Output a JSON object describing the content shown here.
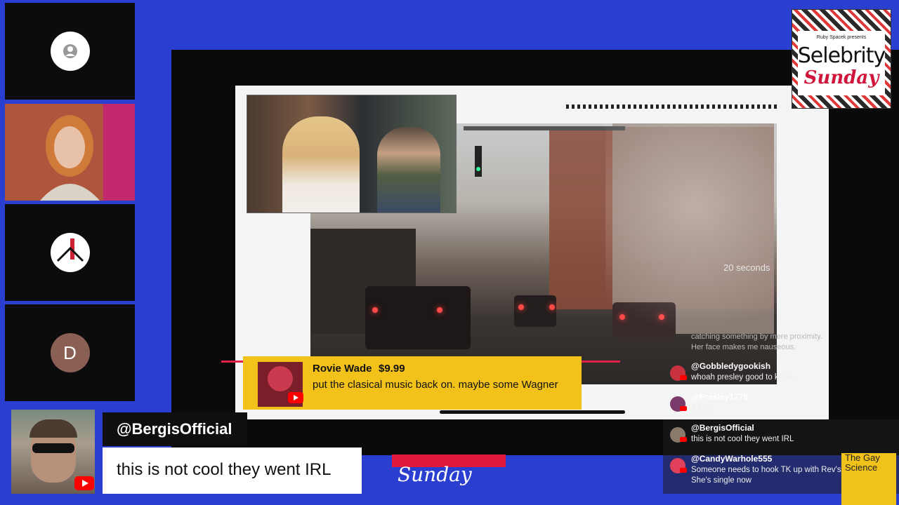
{
  "participants": {
    "tile1": {
      "icon": "user-icon"
    },
    "tile2": {
      "icon": "video-feed"
    },
    "tile3": {
      "icon": "logo-avatar"
    },
    "tile4": {
      "initial": "D"
    }
  },
  "stage": {
    "timer_text": "20 seconds"
  },
  "superchat": {
    "name": "Rovie Wade",
    "amount": "$9.99",
    "message": "put the clasical music back on. maybe some Wagner"
  },
  "logo": {
    "presents": "Ruby Spacek presents",
    "title": "Selebrity",
    "subtitle": "Sunday"
  },
  "chat": {
    "faded_lines": [
      "catching something by mere proximity.",
      "Her face makes me nauseous."
    ],
    "messages": [
      {
        "user": "@Gobbledygookish",
        "text": "whoah presley good to know"
      },
      {
        "user": "@Presley1776",
        "text": "2 fer 1"
      },
      {
        "user": "@BergisOfficial",
        "text": "this is not cool they went IRL"
      },
      {
        "user": "@CandyWarhole555",
        "text": "Someone needs to hook TK up with Rev's Essie",
        "text2": "She's single now"
      }
    ]
  },
  "lower_third": {
    "handle": "@BergisOfficial",
    "message": "this is not cool they went IRL"
  },
  "bottom": {
    "sunday": "Sunday",
    "book_text": "The Gay Science"
  }
}
